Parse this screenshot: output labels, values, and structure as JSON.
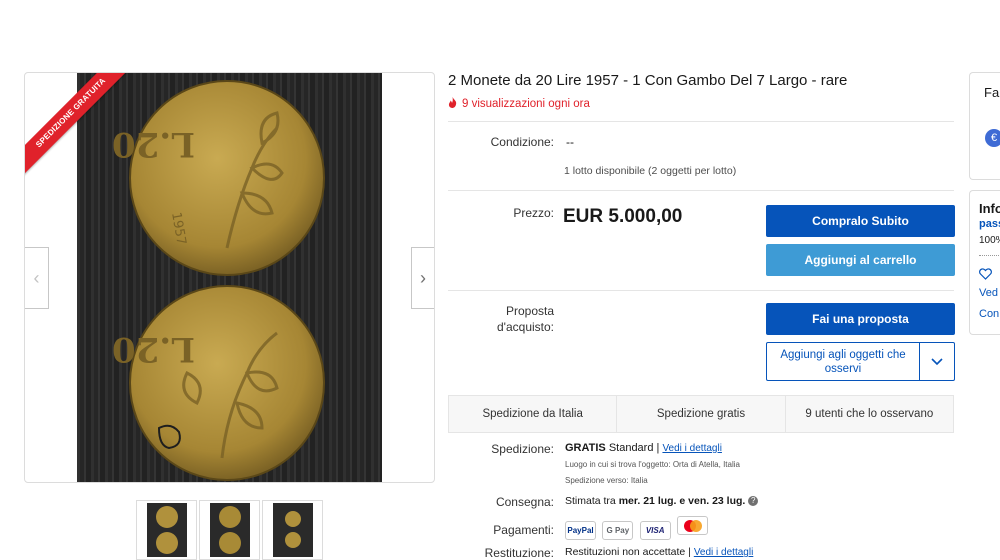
{
  "gallery": {
    "ribbon": "SPEDIZIONE GRATUITA",
    "prev_icon": "chevron-left-icon",
    "next_icon": "chevron-right-icon",
    "thumbnails_count": 3
  },
  "listing": {
    "title": "2 Monete da 20 Lire 1957 - 1 Con Gambo Del 7 Largo - rare",
    "views": "9 visualizzazioni ogni ora",
    "condition_label": "Condizione:",
    "condition_value": "--",
    "lot_info": "1 lotto disponibile (2 oggetti per lotto)",
    "price_label": "Prezzo:",
    "price": "EUR 5.000,00",
    "buy_now": "Compralo Subito",
    "add_to_cart": "Aggiungi al carrello",
    "offer_label": "Proposta d'acquisto:",
    "make_offer": "Fai una proposta",
    "watch": "Aggiungi agli oggetti che osservi"
  },
  "ship_strip": [
    "Spedizione da Italia",
    "Spedizione gratis",
    "9 utenti che lo osservano"
  ],
  "details": {
    "shipping_label": "Spedizione:",
    "shipping_free": "GRATIS",
    "shipping_standard": "Standard |",
    "see_details": "Vedi i dettagli",
    "location_line": "Luogo in cui si trova l'oggetto:  Orta di Atella, Italia",
    "ships_to_line": "Spedizione verso:  Italia",
    "delivery_label": "Consegna:",
    "delivery_text": "Stimata tra",
    "delivery_dates": "mer. 21 lug. e ven. 23 lug.",
    "payments_label": "Pagamenti:",
    "payments": [
      "PayPal",
      "G Pay",
      "VISA",
      "MC"
    ],
    "returns_label": "Restituzione:",
    "returns_text": "Restituzioni non accettate |",
    "returns_link": "Vedi i dettagli"
  },
  "sidebar": {
    "box1_title": "Fai",
    "box2_title": "Info",
    "box2_link": "pass",
    "box2_pct": "100%",
    "save": "Ved",
    "contact": "Con"
  },
  "colors": {
    "primary": "#0654ba",
    "secondary": "#3e9bd5",
    "red": "#e0222b",
    "coin": "#b0913c"
  }
}
